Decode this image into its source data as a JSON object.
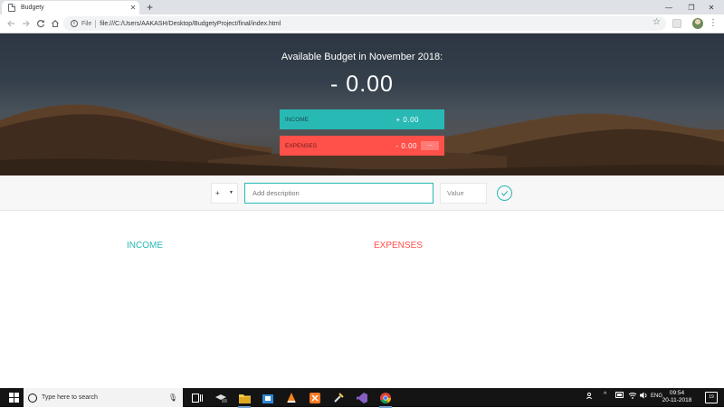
{
  "browser": {
    "tab_title": "Budgety",
    "tab_close": "✕",
    "new_tab": "+",
    "file_chip": "File",
    "url": "file:///C:/Users/AAKASH/Desktop/BudgetyProject/final/index.html",
    "minimize": "—",
    "maximize": "❐",
    "close": "✕"
  },
  "budget": {
    "title_prefix": "Available Budget in",
    "month": "November 2018",
    "title": "Available Budget in November 2018:",
    "value": "- 0.00",
    "income_label": "Income",
    "income_value": "+ 0.00",
    "expenses_label": "Expenses",
    "expenses_value": "- 0.00",
    "expenses_percentage": "---"
  },
  "add_form": {
    "type_value": "+",
    "description_placeholder": "Add description",
    "value_placeholder": "Value"
  },
  "lists": {
    "income_title": "Income",
    "expenses_title": "Expenses"
  },
  "colors": {
    "income": "#28b9b5",
    "expenses": "#ff5049"
  },
  "taskbar": {
    "search_placeholder": "Type here to search",
    "lang": "ENG",
    "time": "09:54",
    "date": "20-11-2018",
    "notifications": "19"
  }
}
